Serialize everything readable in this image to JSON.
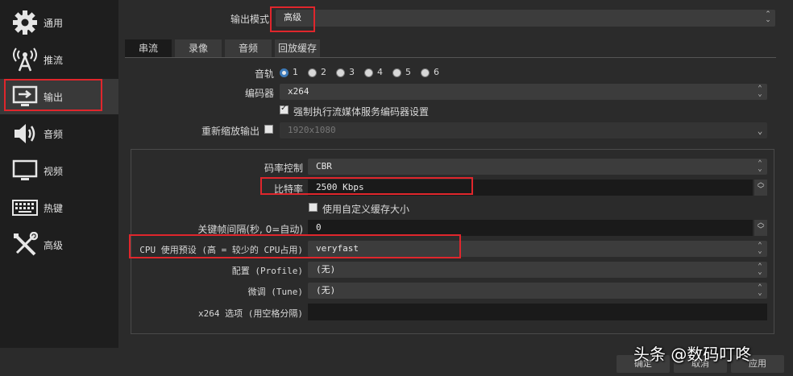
{
  "sidebar": {
    "items": [
      {
        "label": "通用",
        "icon": "gear-icon"
      },
      {
        "label": "推流",
        "icon": "broadcast-antenna-icon"
      },
      {
        "label": "输出",
        "icon": "output-monitor-icon"
      },
      {
        "label": "音频",
        "icon": "speaker-icon"
      },
      {
        "label": "视频",
        "icon": "monitor-icon"
      },
      {
        "label": "热键",
        "icon": "keyboard-icon"
      },
      {
        "label": "高级",
        "icon": "tools-icon"
      }
    ]
  },
  "output_mode": {
    "label": "输出模式",
    "value": "高级"
  },
  "tabs": [
    {
      "label": "串流",
      "active": true
    },
    {
      "label": "录像"
    },
    {
      "label": "音频"
    },
    {
      "label": "回放缓存"
    }
  ],
  "audio_track": {
    "label": "音轨",
    "options": [
      "1",
      "2",
      "3",
      "4",
      "5",
      "6"
    ],
    "selected": "1"
  },
  "encoder": {
    "label": "编码器",
    "value": "x264"
  },
  "enforce_streaming": {
    "label": "强制执行流媒体服务编码器设置",
    "checked": true
  },
  "rescale": {
    "label": "重新缩放输出",
    "checked": false,
    "value": "1920x1080"
  },
  "rate_control": {
    "label": "码率控制",
    "value": "CBR"
  },
  "bitrate": {
    "label": "比特率",
    "value": "2500 Kbps"
  },
  "custom_buffer": {
    "label": "使用自定义缓存大小",
    "checked": false
  },
  "keyframe": {
    "label": "关键帧间隔(秒, 0=自动)",
    "value": "0"
  },
  "cpu_preset": {
    "label": "CPU 使用预设 (高 = 较少的 CPU占用)",
    "value": "veryfast"
  },
  "profile": {
    "label": "配置 (Profile)",
    "value": "(无)"
  },
  "tune": {
    "label": "微调 (Tune)",
    "value": "(无)"
  },
  "x264_options": {
    "label": "x264 选项 (用空格分隔)",
    "value": ""
  },
  "buttons": {
    "ok": "确定",
    "cancel": "取消",
    "apply": "应用"
  },
  "watermark": "头条 @数码叮咚",
  "colors": {
    "highlight_red": "#e0262c",
    "radio_blue": "#3d7ab8",
    "background": "#2b2b2b"
  }
}
